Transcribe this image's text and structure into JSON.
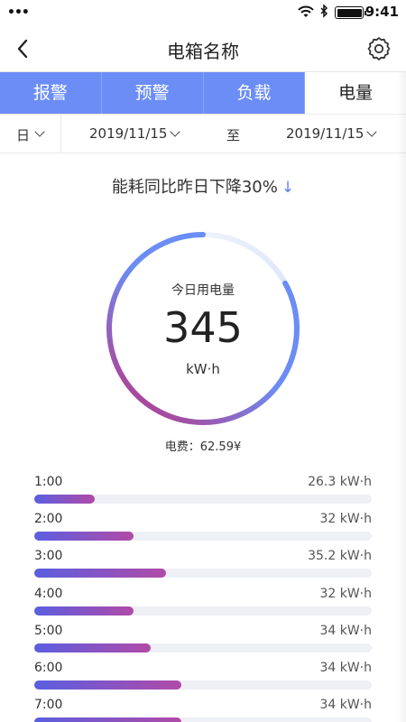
{
  "status_bar": {
    "signal_dots": "•••",
    "time": "9:41",
    "icons": [
      "wifi-icon",
      "bluetooth-icon",
      "battery-icon"
    ]
  },
  "nav": {
    "title": "电箱名称",
    "back_icon": "back-chevron-icon",
    "settings_icon": "gear-icon"
  },
  "tabs": [
    {
      "label": "报警",
      "active": false
    },
    {
      "label": "预警",
      "active": false
    },
    {
      "label": "负载",
      "active": false
    },
    {
      "label": "电量",
      "active": true
    }
  ],
  "filter": {
    "period": "日",
    "start_date": "2019/11/15",
    "separator": "至",
    "end_date": "2019/11/15"
  },
  "summary": {
    "compare_text": "能耗同比昨日下降30%",
    "trend_arrow": "↓"
  },
  "gauge": {
    "label": "今日用电量",
    "value": "345",
    "unit": "kW·h",
    "fraction": 0.83
  },
  "fee": {
    "text": "电费：62.59¥"
  },
  "hourly": [
    {
      "hour": "1:00",
      "value_text": "26.3 kW·h",
      "fraction": 0.18
    },
    {
      "hour": "2:00",
      "value_text": "32 kW·h",
      "fraction": 0.295
    },
    {
      "hour": "3:00",
      "value_text": "35.2 kW·h",
      "fraction": 0.39
    },
    {
      "hour": "4:00",
      "value_text": "32 kW·h",
      "fraction": 0.295
    },
    {
      "hour": "5:00",
      "value_text": "34 kW·h",
      "fraction": 0.345
    },
    {
      "hour": "6:00",
      "value_text": "34 kW·h",
      "fraction": 0.435
    },
    {
      "hour": "7:00",
      "value_text": "34 kW·h",
      "fraction": 0.435
    }
  ],
  "colors": {
    "accent": "#6b8df5",
    "bar_start": "#5b5fe0",
    "bar_end": "#b04aa8",
    "gauge_start": "#6b8df5",
    "gauge_end": "#b13f8f"
  }
}
